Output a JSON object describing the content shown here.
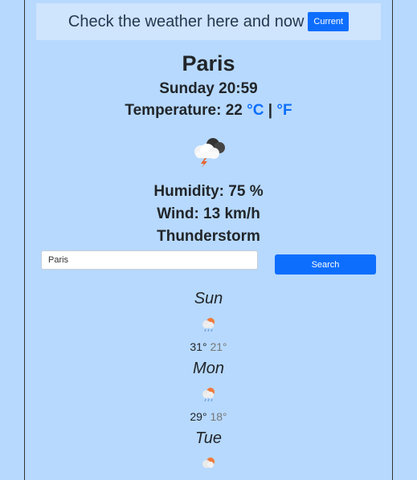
{
  "banner": {
    "text": "Check the weather here and now",
    "button": "Current"
  },
  "weather": {
    "city": "Paris",
    "datetime": "Sunday 20:59",
    "temperature_label": "Temperature: ",
    "temperature": "22",
    "unit_c": "°C",
    "unit_sep": "|",
    "unit_f": "°F",
    "humidity": "Humidity: 75 %",
    "wind": "Wind: 13 km/h",
    "description": "Thunderstorm",
    "icon": "thunderstorm-icon"
  },
  "search": {
    "value": "Paris",
    "button": "Search"
  },
  "forecast": [
    {
      "day": "Sun",
      "high": "31°",
      "low": "21°",
      "icon": "rain-sun-icon"
    },
    {
      "day": "Mon",
      "high": "29°",
      "low": "18°",
      "icon": "rain-sun-icon"
    },
    {
      "day": "Tue",
      "icon": "rain-sun-icon"
    }
  ],
  "colors": {
    "background": "#b7d9fe",
    "banner": "#cfe4fd",
    "accent": "#0d6efd"
  }
}
